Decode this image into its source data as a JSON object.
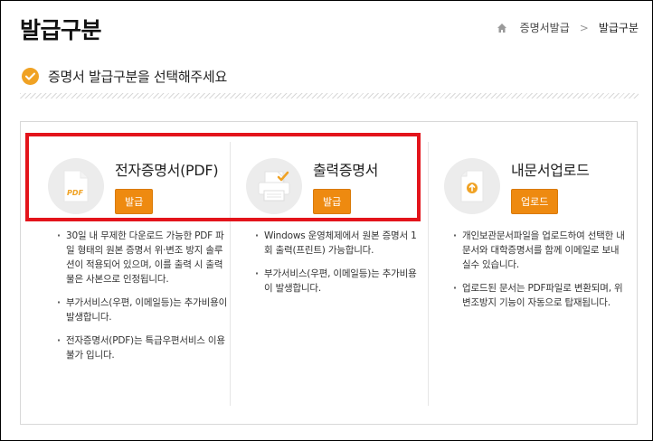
{
  "page": {
    "title": "발급구분",
    "breadcrumb": {
      "home_icon": "home-icon",
      "items": [
        "증명서발급",
        "발급구분"
      ],
      "separator": ">"
    },
    "subtitle": "증명서 발급구분을 선택해주세요",
    "accent_color": "#f0a224",
    "highlight_color": "#e3141b"
  },
  "options": [
    {
      "title": "전자증명서(PDF)",
      "button": "발급",
      "icon": "pdf-file-icon",
      "pdf_label": "PDF",
      "bullets": [
        "30일 내 무제한 다운로드 가능한 PDF 파일 형태의 원본 증명서 위·변조 방지 솔루션이 적용되어 있으며, 이를 출력 시 출력물은 사본으로 인정됩니다.",
        "부가서비스(우편, 이메일등)는 추가비용이 발생합니다.",
        "전자증명서(PDF)는 특급우편서비스 이용불가 입니다."
      ]
    },
    {
      "title": "출력증명서",
      "button": "발급",
      "icon": "printer-icon",
      "bullets": [
        "Windows 운영체제에서 원본 증명서 1회 출력(프린트) 가능합니다.",
        "부가서비스(우편, 이메일등)는 추가비용이 발생합니다."
      ]
    },
    {
      "title": "내문서업로드",
      "button": "업로드",
      "icon": "upload-document-icon",
      "bullets": [
        "개인보관문서파일을 업로드하여 선택한 내문서와 대학증명서를 함께 이메일로 보내실수 있습니다.",
        "업로드된 문서는 PDF파일로 변환되며, 위변조방지 기능이 자동으로 탑재됩니다."
      ]
    }
  ]
}
